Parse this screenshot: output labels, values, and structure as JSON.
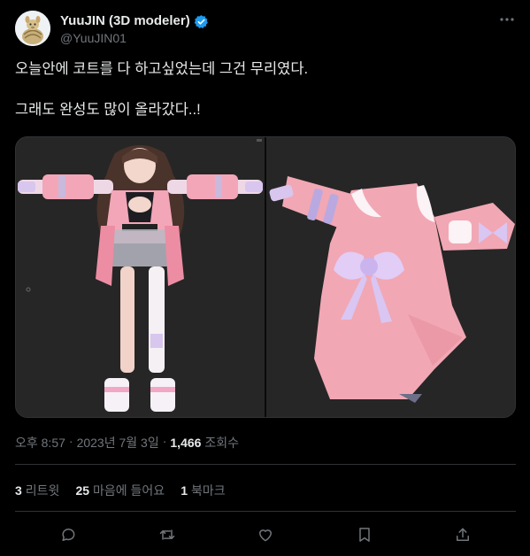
{
  "author": {
    "display_name": "YuuJIN (3D modeler)",
    "handle": "@YuuJIN01",
    "verified": true,
    "avatar_icon": "avatar-armadillo"
  },
  "more_icon": "more-dots-icon",
  "tweet_text": {
    "line1": "오늘안에 코트를 다 하고싶었는데 그건 무리였다.",
    "line2": "그래도 완성도 많이 올라갔다..!"
  },
  "media": {
    "left_alt_icon": "character-model-render",
    "right_alt_icon": "coat-model-render"
  },
  "meta": {
    "time": "오후 8:57",
    "date": "2023년 7월 3일",
    "views_count": "1,466",
    "views_label": "조회수",
    "dot": "·"
  },
  "stats": {
    "retweets_count": "3",
    "retweets_label": "리트윗",
    "likes_count": "25",
    "likes_label": "마음에 들어요",
    "bookmarks_count": "1",
    "bookmarks_label": "북마크"
  },
  "colors": {
    "background": "#000000",
    "text": "#e7e9ea",
    "muted": "#71767b",
    "border": "#2f3336",
    "verified": "#1d9bf0",
    "coat_pink": "#f2a7b4"
  }
}
